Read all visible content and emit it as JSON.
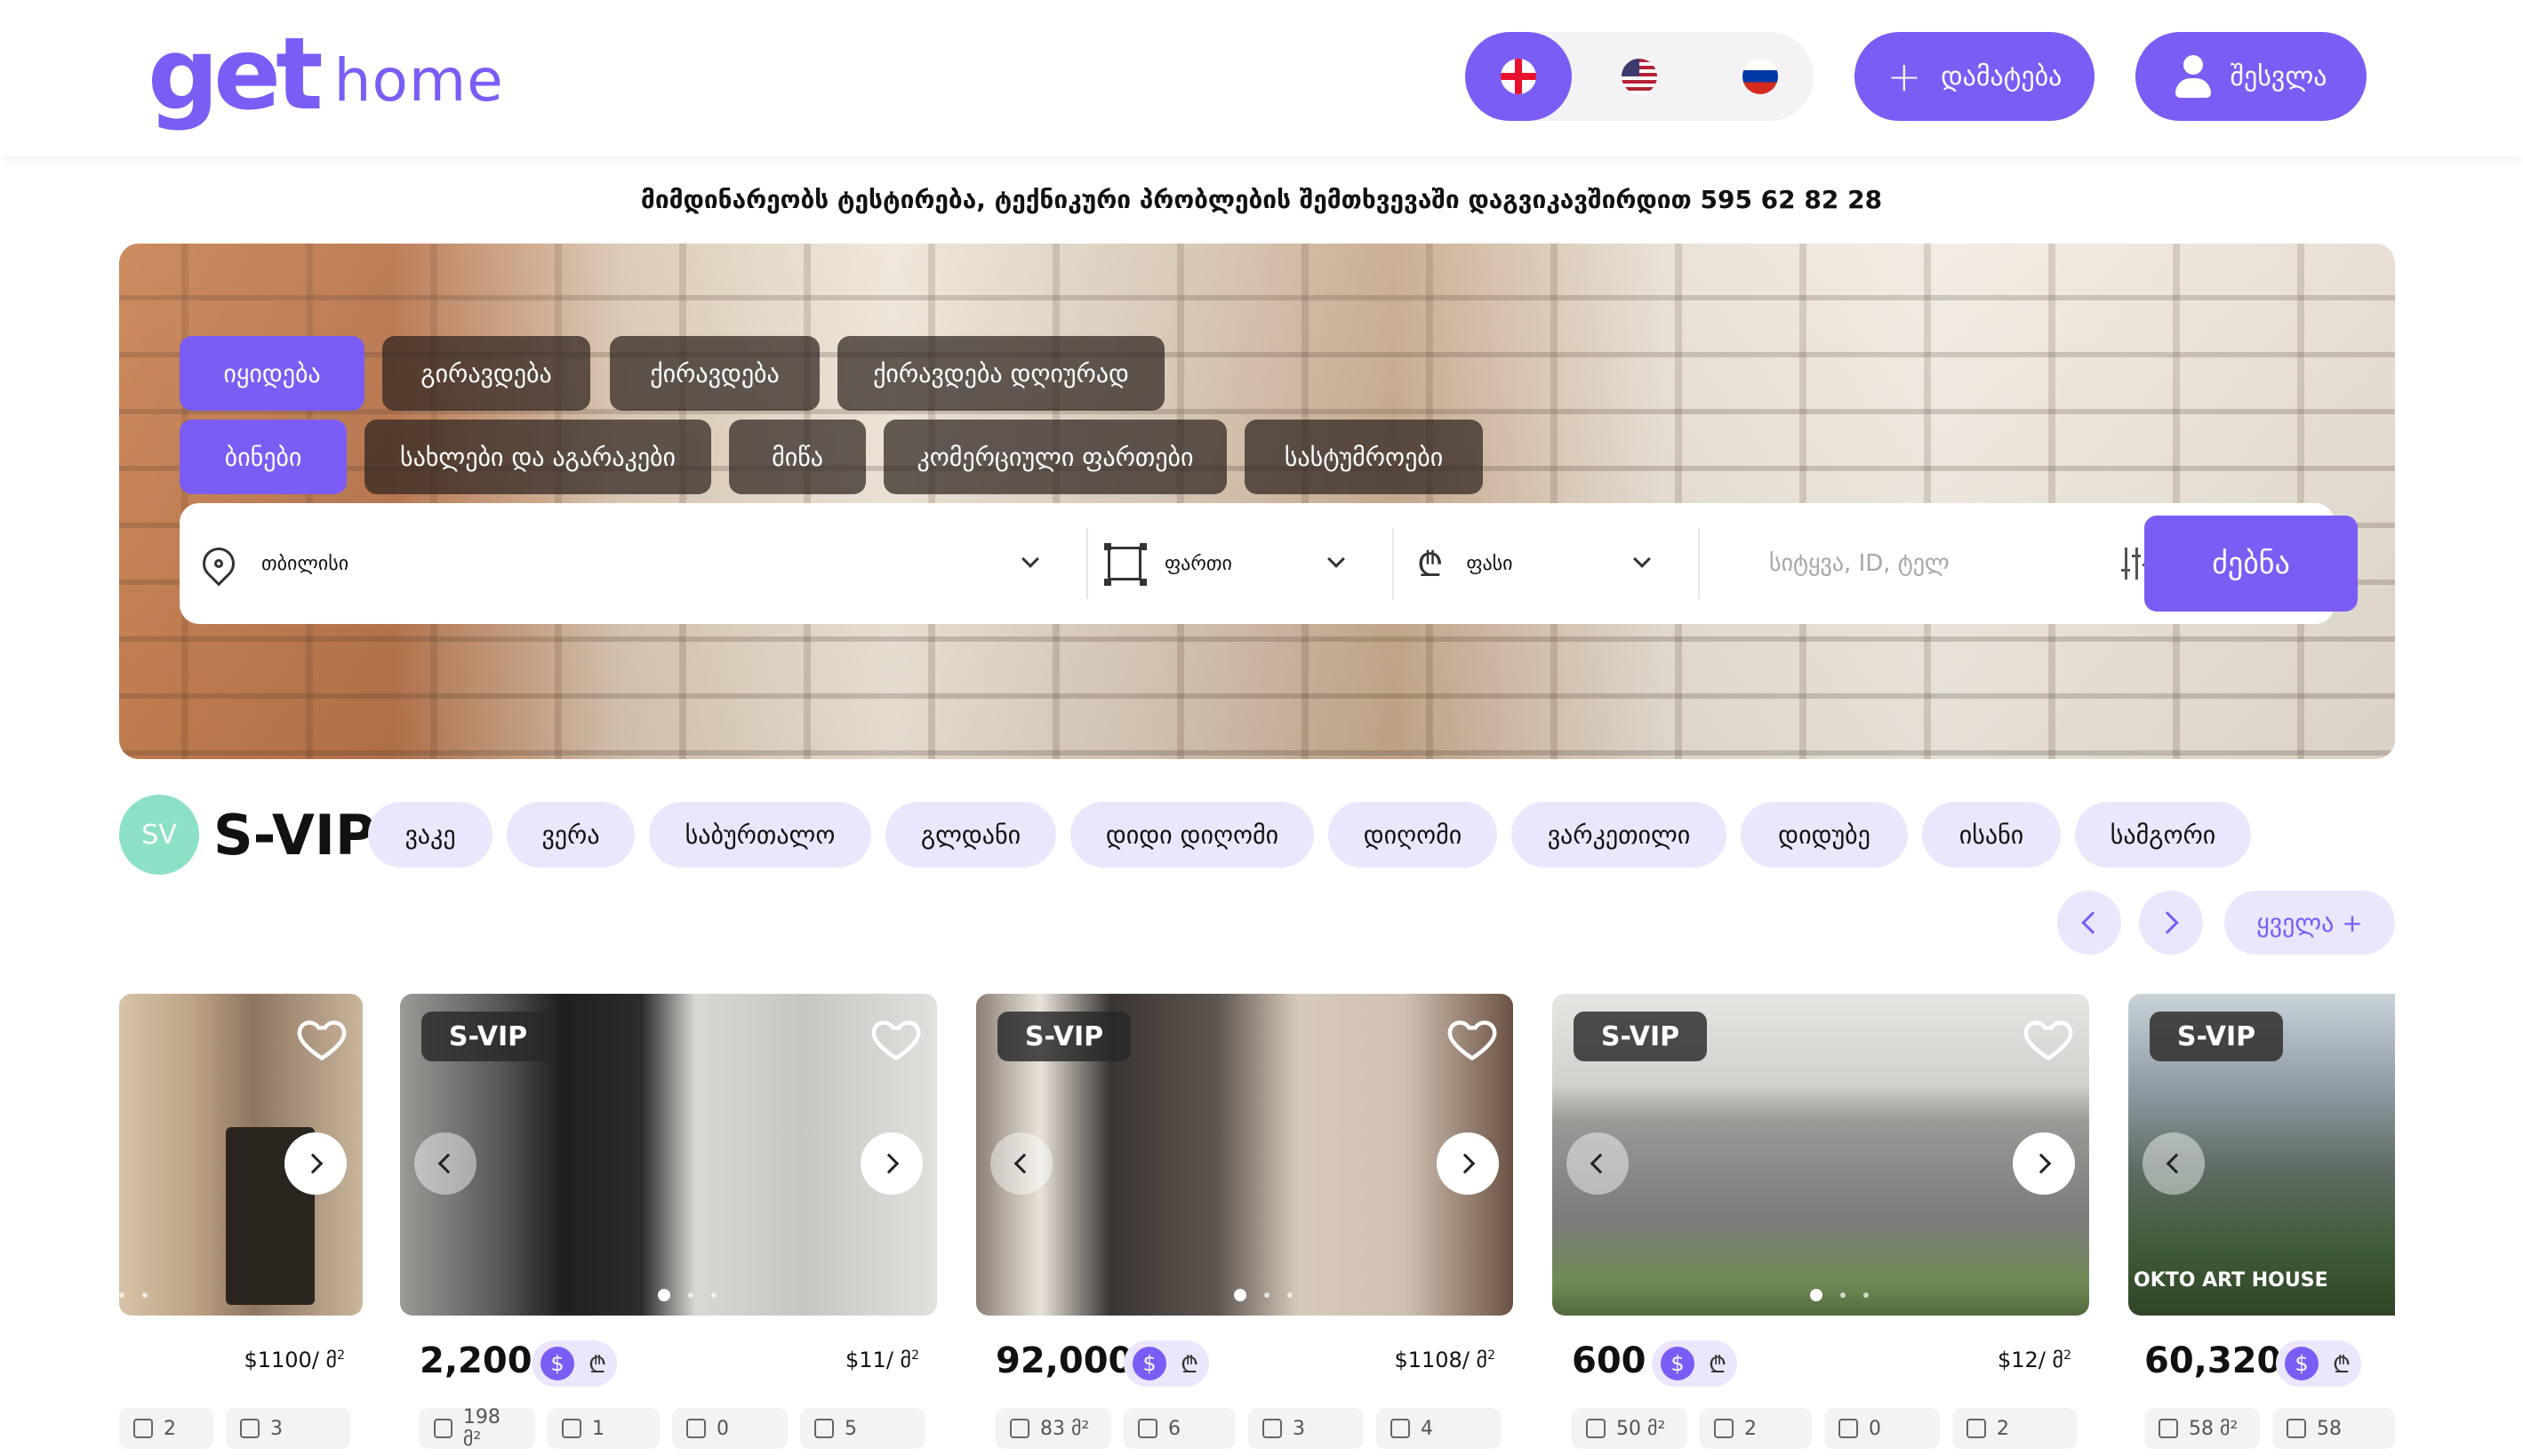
{
  "header": {
    "logo_main": "get",
    "logo_sub": "home",
    "languages": [
      {
        "code": "ka",
        "flag": "georgia-flag-icon",
        "active": true
      },
      {
        "code": "en",
        "flag": "usa-flag-icon",
        "active": false
      },
      {
        "code": "ru",
        "flag": "russia-flag-icon",
        "active": false
      }
    ],
    "add_label": "დამატება",
    "login_label": "შესვლა"
  },
  "notice": "მიმდინარეობს ტესტირება, ტექნიკური პრობლების შემთხვევაში დაგვიკავშირდით 595 62 82 28",
  "deal_types": [
    "იყიდება",
    "ქირავდება",
    "ქირავდება",
    "ქირავდება დღიურად"
  ],
  "deal_labels": {
    "buy": "იყიდება",
    "pledge": "გირავდება",
    "rent": "ქირავდება",
    "daily": "ქირავდება დღიურად"
  },
  "property_types": {
    "flats": "ბინები",
    "houses": "სახლები და აგარაკები",
    "land": "მიწა",
    "commercial": "კომერციული ფართები",
    "hotels": "სასტუმროები"
  },
  "search": {
    "city": "თბილისი",
    "area_label": "ფართი",
    "price_label": "ფასი",
    "placeholder": "სიტყვა, ID, ტელ",
    "button": "ძებნა"
  },
  "svip": {
    "badge": "SV",
    "title": "S-VIP",
    "districts": [
      "ვაკე",
      "ვერა",
      "საბურთალო",
      "გლდანი",
      "დიდი დიღომი",
      "დიღომი",
      "ვარკეთილი",
      "დიდუბე",
      "ისანი",
      "სამგორი"
    ],
    "all_label": "ყველა +"
  },
  "colors": {
    "accent": "#7b5cf5",
    "accent_light": "#ece6fd",
    "badge": "#8de0c8"
  },
  "cards": [
    {
      "tag": "",
      "price": "",
      "per_sqm": "$1100/ მ",
      "features": [
        "2",
        "3"
      ]
    },
    {
      "tag": "S-VIP",
      "price": "2,200",
      "per_sqm": "$11/ მ",
      "features": [
        "198 მ²",
        "1",
        "0",
        "5"
      ]
    },
    {
      "tag": "S-VIP",
      "price": "92,000",
      "per_sqm": "$1108/ მ",
      "features": [
        "83 მ²",
        "6",
        "3",
        "4"
      ]
    },
    {
      "tag": "S-VIP",
      "price": "600",
      "per_sqm": "$12/ მ",
      "features": [
        "50 მ²",
        "2",
        "0",
        "2"
      ]
    },
    {
      "tag": "S-VIP",
      "price": "60,320",
      "per_sqm": "",
      "features": [
        "58 მ²",
        "58"
      ]
    }
  ],
  "card5_overlay": "OKTO ART HOUSE",
  "currency": {
    "usd": "$",
    "gel": "₾"
  }
}
